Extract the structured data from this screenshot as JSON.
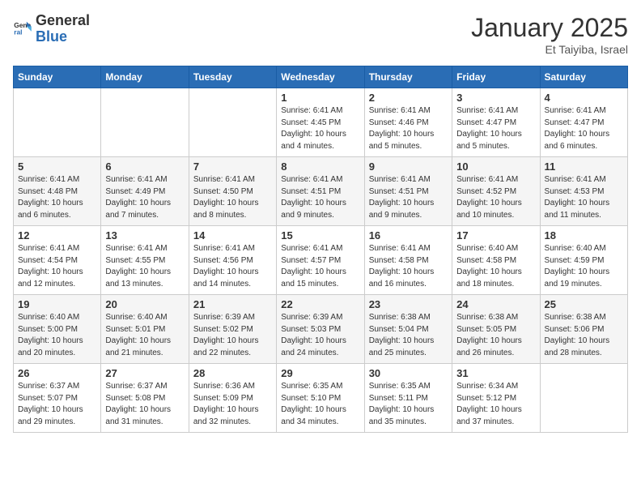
{
  "header": {
    "logo_general": "General",
    "logo_blue": "Blue",
    "month_title": "January 2025",
    "subtitle": "Et Taiyiba, Israel"
  },
  "days_of_week": [
    "Sunday",
    "Monday",
    "Tuesday",
    "Wednesday",
    "Thursday",
    "Friday",
    "Saturday"
  ],
  "weeks": [
    [
      {
        "day": "",
        "info": ""
      },
      {
        "day": "",
        "info": ""
      },
      {
        "day": "",
        "info": ""
      },
      {
        "day": "1",
        "info": "Sunrise: 6:41 AM\nSunset: 4:45 PM\nDaylight: 10 hours\nand 4 minutes."
      },
      {
        "day": "2",
        "info": "Sunrise: 6:41 AM\nSunset: 4:46 PM\nDaylight: 10 hours\nand 5 minutes."
      },
      {
        "day": "3",
        "info": "Sunrise: 6:41 AM\nSunset: 4:47 PM\nDaylight: 10 hours\nand 5 minutes."
      },
      {
        "day": "4",
        "info": "Sunrise: 6:41 AM\nSunset: 4:47 PM\nDaylight: 10 hours\nand 6 minutes."
      }
    ],
    [
      {
        "day": "5",
        "info": "Sunrise: 6:41 AM\nSunset: 4:48 PM\nDaylight: 10 hours\nand 6 minutes."
      },
      {
        "day": "6",
        "info": "Sunrise: 6:41 AM\nSunset: 4:49 PM\nDaylight: 10 hours\nand 7 minutes."
      },
      {
        "day": "7",
        "info": "Sunrise: 6:41 AM\nSunset: 4:50 PM\nDaylight: 10 hours\nand 8 minutes."
      },
      {
        "day": "8",
        "info": "Sunrise: 6:41 AM\nSunset: 4:51 PM\nDaylight: 10 hours\nand 9 minutes."
      },
      {
        "day": "9",
        "info": "Sunrise: 6:41 AM\nSunset: 4:51 PM\nDaylight: 10 hours\nand 9 minutes."
      },
      {
        "day": "10",
        "info": "Sunrise: 6:41 AM\nSunset: 4:52 PM\nDaylight: 10 hours\nand 10 minutes."
      },
      {
        "day": "11",
        "info": "Sunrise: 6:41 AM\nSunset: 4:53 PM\nDaylight: 10 hours\nand 11 minutes."
      }
    ],
    [
      {
        "day": "12",
        "info": "Sunrise: 6:41 AM\nSunset: 4:54 PM\nDaylight: 10 hours\nand 12 minutes."
      },
      {
        "day": "13",
        "info": "Sunrise: 6:41 AM\nSunset: 4:55 PM\nDaylight: 10 hours\nand 13 minutes."
      },
      {
        "day": "14",
        "info": "Sunrise: 6:41 AM\nSunset: 4:56 PM\nDaylight: 10 hours\nand 14 minutes."
      },
      {
        "day": "15",
        "info": "Sunrise: 6:41 AM\nSunset: 4:57 PM\nDaylight: 10 hours\nand 15 minutes."
      },
      {
        "day": "16",
        "info": "Sunrise: 6:41 AM\nSunset: 4:58 PM\nDaylight: 10 hours\nand 16 minutes."
      },
      {
        "day": "17",
        "info": "Sunrise: 6:40 AM\nSunset: 4:58 PM\nDaylight: 10 hours\nand 18 minutes."
      },
      {
        "day": "18",
        "info": "Sunrise: 6:40 AM\nSunset: 4:59 PM\nDaylight: 10 hours\nand 19 minutes."
      }
    ],
    [
      {
        "day": "19",
        "info": "Sunrise: 6:40 AM\nSunset: 5:00 PM\nDaylight: 10 hours\nand 20 minutes."
      },
      {
        "day": "20",
        "info": "Sunrise: 6:40 AM\nSunset: 5:01 PM\nDaylight: 10 hours\nand 21 minutes."
      },
      {
        "day": "21",
        "info": "Sunrise: 6:39 AM\nSunset: 5:02 PM\nDaylight: 10 hours\nand 22 minutes."
      },
      {
        "day": "22",
        "info": "Sunrise: 6:39 AM\nSunset: 5:03 PM\nDaylight: 10 hours\nand 24 minutes."
      },
      {
        "day": "23",
        "info": "Sunrise: 6:38 AM\nSunset: 5:04 PM\nDaylight: 10 hours\nand 25 minutes."
      },
      {
        "day": "24",
        "info": "Sunrise: 6:38 AM\nSunset: 5:05 PM\nDaylight: 10 hours\nand 26 minutes."
      },
      {
        "day": "25",
        "info": "Sunrise: 6:38 AM\nSunset: 5:06 PM\nDaylight: 10 hours\nand 28 minutes."
      }
    ],
    [
      {
        "day": "26",
        "info": "Sunrise: 6:37 AM\nSunset: 5:07 PM\nDaylight: 10 hours\nand 29 minutes."
      },
      {
        "day": "27",
        "info": "Sunrise: 6:37 AM\nSunset: 5:08 PM\nDaylight: 10 hours\nand 31 minutes."
      },
      {
        "day": "28",
        "info": "Sunrise: 6:36 AM\nSunset: 5:09 PM\nDaylight: 10 hours\nand 32 minutes."
      },
      {
        "day": "29",
        "info": "Sunrise: 6:35 AM\nSunset: 5:10 PM\nDaylight: 10 hours\nand 34 minutes."
      },
      {
        "day": "30",
        "info": "Sunrise: 6:35 AM\nSunset: 5:11 PM\nDaylight: 10 hours\nand 35 minutes."
      },
      {
        "day": "31",
        "info": "Sunrise: 6:34 AM\nSunset: 5:12 PM\nDaylight: 10 hours\nand 37 minutes."
      },
      {
        "day": "",
        "info": ""
      }
    ]
  ]
}
